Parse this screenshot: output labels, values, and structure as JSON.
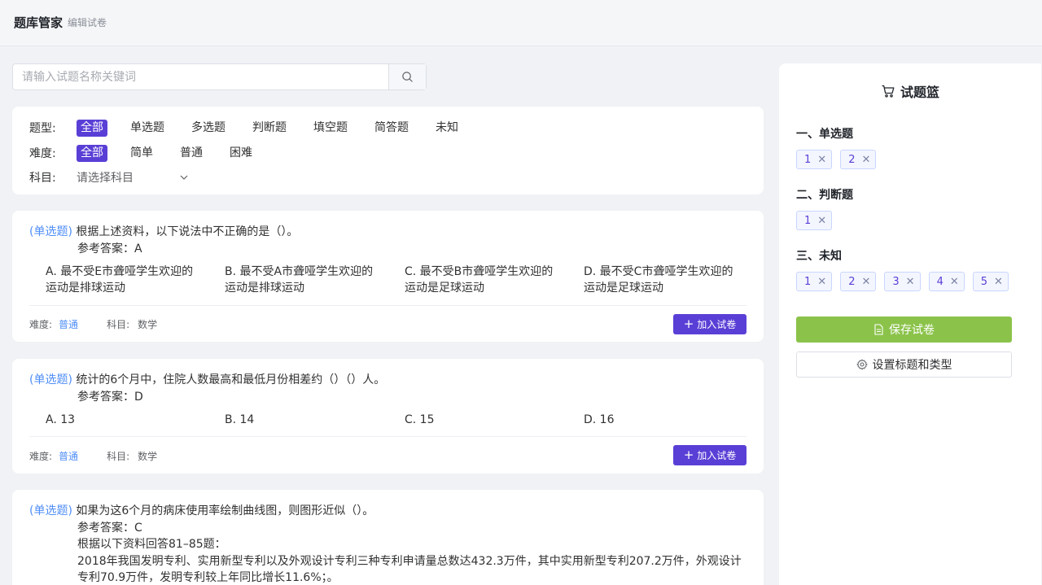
{
  "header": {
    "title": "题库管家",
    "subtitle": "编辑试卷"
  },
  "search": {
    "placeholder": "请输入试题名称关键词",
    "icon": "search-icon"
  },
  "filters": {
    "type_label": "题型:",
    "types": [
      "全部",
      "单选题",
      "多选题",
      "判断题",
      "填空题",
      "简答题",
      "未知"
    ],
    "difficulty_label": "难度:",
    "difficulties": [
      "全部",
      "简单",
      "普通",
      "困难"
    ],
    "subject_label": "科目:",
    "subject_placeholder": "请选择科目"
  },
  "questions": [
    {
      "type": "(单选题)",
      "text": "根据上述资料，以下说法中不正确的是（）。",
      "answer": "参考答案：A",
      "options": [
        "A. 最不受E市聋哑学生欢迎的运动是排球运动",
        "B. 最不受A市聋哑学生欢迎的运动是排球运动",
        "C. 最不受B市聋哑学生欢迎的运动是足球运动",
        "D. 最不受C市聋哑学生欢迎的运动是足球运动"
      ],
      "difficulty_label": "难度:",
      "difficulty": "普通",
      "subject_label": "科目:",
      "subject": "数学",
      "add_label": "加入试卷"
    },
    {
      "type": "(单选题)",
      "text": "统计的6个月中，住院人数最高和最低月份相差约（）（）人。",
      "answer": "参考答案：D",
      "options": [
        "A. 13",
        "B. 14",
        "C. 15",
        "D. 16"
      ],
      "difficulty_label": "难度:",
      "difficulty": "普通",
      "subject_label": "科目:",
      "subject": "数学",
      "add_label": "加入试卷"
    },
    {
      "type": "(单选题)",
      "text": "如果为这6个月的病床使用率绘制曲线图，则图形近似（）。",
      "answer": "参考答案：C",
      "material_title": "根据以下资料回答81–85题：",
      "material_line1": "2018年我国发明专利、实用新型专利以及外观设计专利三种专利申请量总数达432.3万件，其中实用新型专利207.2万件，外观设计",
      "material_line2": "专利70.9万件，发明专利较上年同比增长11.6%；。"
    }
  ],
  "basket": {
    "title": "试题篮",
    "sections": [
      {
        "title": "一、单选题",
        "items": [
          "1",
          "2"
        ]
      },
      {
        "title": "二、判断题",
        "items": [
          "1"
        ]
      },
      {
        "title": "三、未知",
        "items": [
          "1",
          "2",
          "3",
          "4",
          "5"
        ]
      }
    ],
    "save_label": "保存试卷",
    "settings_label": "设置标题和类型"
  },
  "colors": {
    "accent": "#5a3fd6",
    "link": "#4f8ef7",
    "save": "#8bc34a"
  }
}
